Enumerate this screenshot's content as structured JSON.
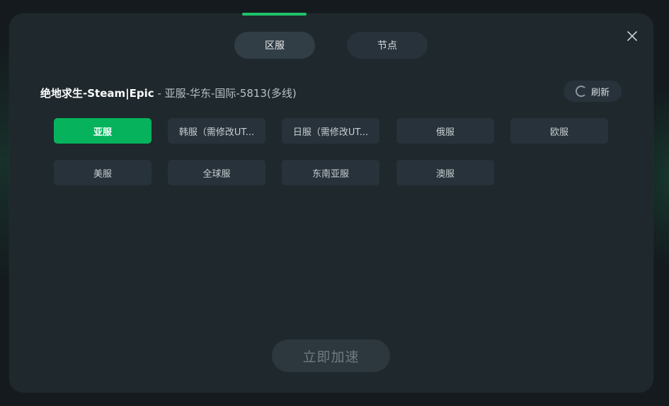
{
  "tabs": [
    {
      "label": "区服",
      "active": true
    },
    {
      "label": "节点",
      "active": false
    }
  ],
  "header": {
    "game_name": "绝地求生-Steam|Epic",
    "separator": " - ",
    "server_name": "亚服-华东-国际-5813(多线)"
  },
  "refresh": {
    "label": "刷新",
    "icon": "loading-spinner-icon"
  },
  "regions": [
    {
      "label": "亚服",
      "active": true
    },
    {
      "label": "韩服（需修改UT...",
      "active": false
    },
    {
      "label": "日服（需修改UT...",
      "active": false
    },
    {
      "label": "俄服",
      "active": false
    },
    {
      "label": "欧服",
      "active": false
    },
    {
      "label": "美服",
      "active": false
    },
    {
      "label": "全球服",
      "active": false
    },
    {
      "label": "东南亚服",
      "active": false
    },
    {
      "label": "澳服",
      "active": false
    }
  ],
  "accelerate": {
    "label": "立即加速",
    "enabled": false
  },
  "close": {
    "icon": "close-icon"
  },
  "colors": {
    "accent": "#06b35c",
    "modal_bg": "#1f282d",
    "button_bg": "#27323a"
  }
}
